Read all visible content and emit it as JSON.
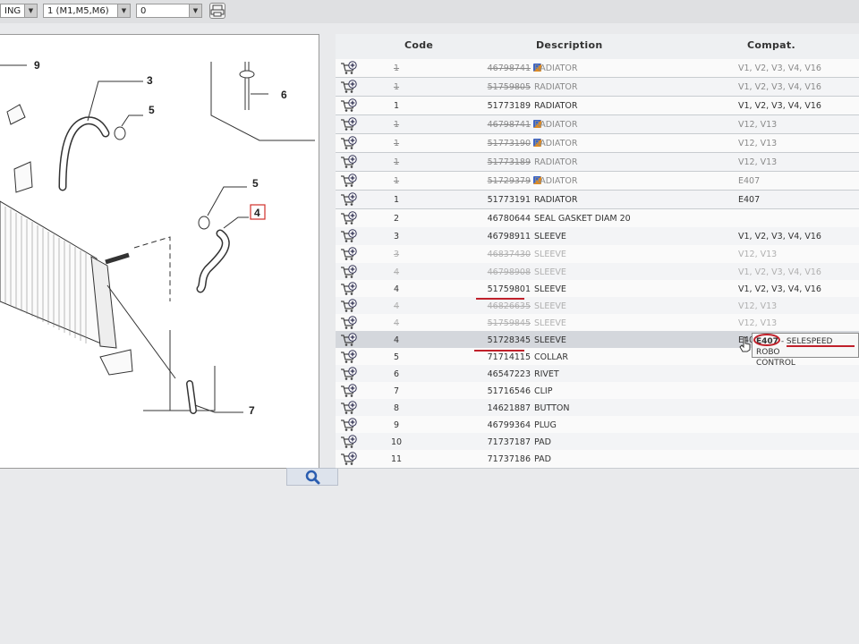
{
  "selectors": [
    {
      "value": "ING",
      "arrow": "▼"
    },
    {
      "value": "1 (M1,M5,M6)",
      "arrow": "▼"
    },
    {
      "value": "0",
      "arrow": "▼"
    }
  ],
  "diagram": {
    "callouts": [
      "9",
      "3",
      "5",
      "6",
      "5",
      "4",
      "7"
    ]
  },
  "table": {
    "headers": {
      "code": "Code",
      "description": "Description",
      "compat": "Compat."
    },
    "rows": [
      {
        "pos": "1",
        "code": "46798741",
        "desc": "RADIATOR",
        "compat": "V1, V2, V3, V4, V16",
        "state": "strike",
        "flag": true
      },
      {
        "pos": "1",
        "code": "51759805",
        "desc": "RADIATOR",
        "compat": "V1, V2, V3, V4, V16",
        "state": "strike",
        "flag": false
      },
      {
        "pos": "1",
        "code": "51773189",
        "desc": "RADIATOR",
        "compat": "V1, V2, V3, V4, V16",
        "state": "normal",
        "flag": false
      },
      {
        "pos": "1",
        "code": "46798741",
        "desc": "RADIATOR",
        "compat": "V12, V13",
        "state": "strike",
        "flag": true
      },
      {
        "pos": "1",
        "code": "51773190",
        "desc": "RADIATOR",
        "compat": "V12, V13",
        "state": "strike",
        "flag": true
      },
      {
        "pos": "1",
        "code": "51773189",
        "desc": "RADIATOR",
        "compat": "V12, V13",
        "state": "strike",
        "flag": false
      },
      {
        "pos": "1",
        "code": "51729379",
        "desc": "RADIATOR",
        "compat": "E407",
        "state": "strike",
        "flag": true
      },
      {
        "pos": "1",
        "code": "51773191",
        "desc": "RADIATOR",
        "compat": "E407",
        "state": "normal",
        "flag": false
      },
      {
        "pos": "2",
        "code": "46780644",
        "desc": "SEAL GASKET DIAM 20",
        "compat": "",
        "state": "normal",
        "flag": false
      },
      {
        "pos": "3",
        "code": "46798911",
        "desc": "SLEEVE",
        "compat": "V1, V2, V3, V4, V16",
        "state": "normal",
        "flag": false
      },
      {
        "pos": "3",
        "code": "46837430",
        "desc": "SLEEVE",
        "compat": "V12, V13",
        "state": "faint",
        "flag": false
      },
      {
        "pos": "4",
        "code": "46798908",
        "desc": "SLEEVE",
        "compat": "V1, V2, V3, V4, V16",
        "state": "faint",
        "flag": false
      },
      {
        "pos": "4",
        "code": "51759801",
        "desc": "SLEEVE",
        "compat": "V1, V2, V3, V4, V16",
        "state": "normal",
        "flag": false
      },
      {
        "pos": "4",
        "code": "46826635",
        "desc": "SLEEVE",
        "compat": "V12, V13",
        "state": "faint",
        "flag": false
      },
      {
        "pos": "4",
        "code": "51759845",
        "desc": "SLEEVE",
        "compat": "V12, V13",
        "state": "faint",
        "flag": false
      },
      {
        "pos": "4",
        "code": "51728345",
        "desc": "SLEEVE",
        "compat": "E407",
        "state": "hl",
        "flag": false
      },
      {
        "pos": "5",
        "code": "71714115",
        "desc": "COLLAR",
        "compat": "",
        "state": "normal",
        "flag": false
      },
      {
        "pos": "6",
        "code": "46547223",
        "desc": "RIVET",
        "compat": "",
        "state": "normal",
        "flag": false
      },
      {
        "pos": "7",
        "code": "51716546",
        "desc": "CLIP",
        "compat": "",
        "state": "normal",
        "flag": false
      },
      {
        "pos": "8",
        "code": "14621887",
        "desc": "BUTTON",
        "compat": "",
        "state": "normal",
        "flag": false
      },
      {
        "pos": "9",
        "code": "46799364",
        "desc": "PLUG",
        "compat": "",
        "state": "normal",
        "flag": false
      },
      {
        "pos": "10",
        "code": "71737187",
        "desc": "PAD",
        "compat": "",
        "state": "normal",
        "flag": false
      },
      {
        "pos": "11",
        "code": "71737186",
        "desc": "PAD",
        "compat": "",
        "state": "normal",
        "flag": false
      }
    ]
  },
  "tooltip": {
    "code": "E407",
    "line1": "- SELESPEED ROBO",
    "line2": "CONTROL"
  },
  "icons": {
    "cart": "add-to-cart-icon",
    "zoom": "magnifier-icon",
    "print": "printer-icon"
  },
  "colors": {
    "annotation_red": "#c0202a",
    "highlight_row": "#d4d7dc",
    "zoom_icon": "#2a5db0"
  }
}
